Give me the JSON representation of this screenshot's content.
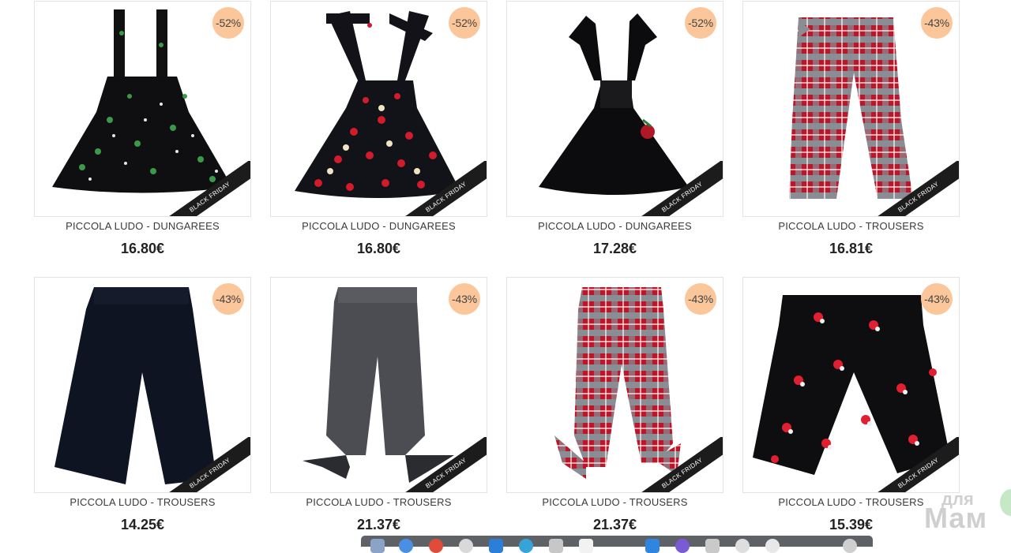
{
  "products": [
    {
      "name": "PICCOLA LUDO - DUNGAREES",
      "price": "16.80€",
      "discount": "-52%",
      "ribbon": "BLACK FRIDAY",
      "art": "dress-floral-green-icon"
    },
    {
      "name": "PICCOLA LUDO - DUNGAREES",
      "price": "16.80€",
      "discount": "-52%",
      "ribbon": "BLACK FRIDAY",
      "art": "dress-apple-icon"
    },
    {
      "name": "PICCOLA LUDO - DUNGAREES",
      "price": "17.28€",
      "discount": "-52%",
      "ribbon": "BLACK FRIDAY",
      "art": "dress-black-icon"
    },
    {
      "name": "PICCOLA LUDO - TROUSERS",
      "price": "16.81€",
      "discount": "-43%",
      "ribbon": "BLACK FRIDAY",
      "art": "trousers-plaid-icon"
    },
    {
      "name": "PICCOLA LUDO - TROUSERS",
      "price": "14.25€",
      "discount": "-43%",
      "ribbon": "BLACK FRIDAY",
      "art": "trousers-navy-icon"
    },
    {
      "name": "PICCOLA LUDO - TROUSERS",
      "price": "21.37€",
      "discount": "-43%",
      "ribbon": "BLACK FRIDAY",
      "art": "trousers-grey-bow-icon"
    },
    {
      "name": "PICCOLA LUDO - TROUSERS",
      "price": "21.37€",
      "discount": "-43%",
      "ribbon": "BLACK FRIDAY",
      "art": "trousers-plaid-bow-icon"
    },
    {
      "name": "PICCOLA LUDO - TROUSERS",
      "price": "15.39€",
      "discount": "-43%",
      "ribbon": "BLACK FRIDAY",
      "art": "trousers-star-print-icon"
    }
  ],
  "watermark": {
    "line1": "для",
    "line2": "Мам"
  },
  "colors": {
    "badge": "#fbc79a",
    "ribbon": "#1c1c1c",
    "border": "#e3e3e3"
  }
}
